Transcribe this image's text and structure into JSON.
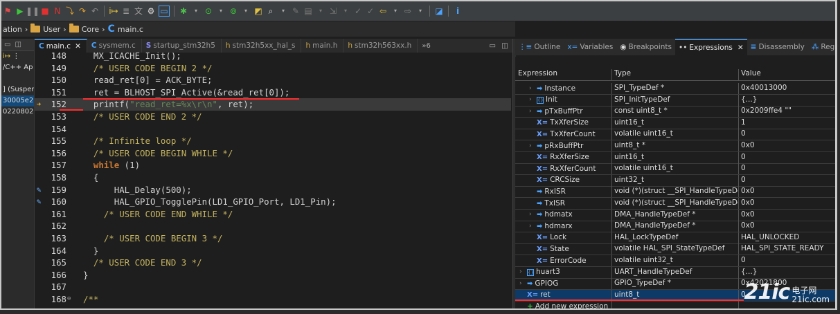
{
  "breadcrumb": {
    "items": [
      "ation",
      "User",
      "Core",
      "main.c"
    ]
  },
  "left_panel": {
    "rows": [
      "/C++ Ap",
      "",
      "] (Susper",
      "30005e2",
      "0220802"
    ]
  },
  "editor_tabs": [
    {
      "label": "main.c",
      "icon": "C",
      "active": true,
      "closable": true
    },
    {
      "label": "sysmem.c",
      "icon": "C"
    },
    {
      "label": "startup_stm32h5",
      "icon": "S"
    },
    {
      "label": "stm32h5xx_hal_s",
      "icon": "h"
    },
    {
      "label": "main.h",
      "icon": "h"
    },
    {
      "label": "stm32h563xx.h",
      "icon": "h"
    }
  ],
  "editor_overflow": "»6",
  "code_lines": [
    {
      "n": "148",
      "text": "  MX_ICACHE_Init();"
    },
    {
      "n": "149",
      "text": "  /* USER CODE BEGIN 2 */",
      "cls": "cm"
    },
    {
      "n": "150",
      "text": "  read_ret[0] = ACK_BYTE;"
    },
    {
      "n": "151",
      "text": "  ret = BLHOST_SPI_Active(&read_ret[0]);"
    },
    {
      "n": "152",
      "pre": "  printf(",
      "str": "\"read_ret=%x\\r\\n\"",
      "post": ", ret);",
      "current": true
    },
    {
      "n": "153",
      "text": "  /* USER CODE END 2 */",
      "cls": "cm"
    },
    {
      "n": "154",
      "text": ""
    },
    {
      "n": "155",
      "text": "  /* Infinite loop */",
      "cls": "cm"
    },
    {
      "n": "156",
      "text": "  /* USER CODE BEGIN WHILE */",
      "cls": "cm"
    },
    {
      "n": "157",
      "kw": "  while",
      "post": " (1)"
    },
    {
      "n": "158",
      "text": "  {"
    },
    {
      "n": "159",
      "text": "      HAL_Delay(500);"
    },
    {
      "n": "160",
      "text": "      HAL_GPIO_TogglePin(LD1_GPIO_Port, LD1_Pin);"
    },
    {
      "n": "161",
      "text": "    /* USER CODE END WHILE */",
      "cls": "cm"
    },
    {
      "n": "162",
      "text": ""
    },
    {
      "n": "163",
      "text": "    /* USER CODE BEGIN 3 */",
      "cls": "cm"
    },
    {
      "n": "164",
      "text": "  }"
    },
    {
      "n": "165",
      "text": "  /* USER CODE END 3 */",
      "cls": "cm"
    },
    {
      "n": "166",
      "text": "}"
    },
    {
      "n": "167",
      "text": ""
    },
    {
      "n": "168",
      "text": "/**",
      "cls": "cm"
    }
  ],
  "right_tabs": [
    {
      "label": "Outline"
    },
    {
      "label": "Variables"
    },
    {
      "label": "Breakpoints"
    },
    {
      "label": "Expressions",
      "active": true
    },
    {
      "label": "Disassembly"
    },
    {
      "label": "Registers"
    }
  ],
  "expressions": {
    "headers": [
      "Expression",
      "Type",
      "Value"
    ],
    "rows": [
      {
        "name": "Instance",
        "type": "SPI_TypeDef *",
        "value": "0x40013000",
        "icon": "pointer",
        "expand": true
      },
      {
        "name": "Init",
        "type": "SPI_InitTypeDef",
        "value": "{...}",
        "icon": "struct",
        "expand": true
      },
      {
        "name": "pTxBuffPtr",
        "type": "const uint8_t *",
        "value": "0x2009ffe4 \"\"",
        "icon": "pointer",
        "expand": true
      },
      {
        "name": "TxXferSize",
        "type": "uint16_t",
        "value": "1",
        "icon": "var"
      },
      {
        "name": "TxXferCount",
        "type": "volatile uint16_t",
        "value": "0",
        "icon": "var"
      },
      {
        "name": "pRxBuffPtr",
        "type": "uint8_t *",
        "value": "0x0",
        "icon": "pointer",
        "expand": true
      },
      {
        "name": "RxXferSize",
        "type": "uint16_t",
        "value": "0",
        "icon": "var"
      },
      {
        "name": "RxXferCount",
        "type": "volatile uint16_t",
        "value": "0",
        "icon": "var"
      },
      {
        "name": "CRCSize",
        "type": "uint32_t",
        "value": "0",
        "icon": "var"
      },
      {
        "name": "RxISR",
        "type": "void (*)(struct __SPI_HandleTypeDef...",
        "value": "0x0",
        "icon": "pointer"
      },
      {
        "name": "TxISR",
        "type": "void (*)(struct __SPI_HandleTypeDef...",
        "value": "0x0",
        "icon": "pointer"
      },
      {
        "name": "hdmatx",
        "type": "DMA_HandleTypeDef *",
        "value": "0x0",
        "icon": "pointer",
        "expand": true
      },
      {
        "name": "hdmarx",
        "type": "DMA_HandleTypeDef *",
        "value": "0x0",
        "icon": "pointer",
        "expand": true
      },
      {
        "name": "Lock",
        "type": "HAL_LockTypeDef",
        "value": "HAL_UNLOCKED",
        "icon": "var"
      },
      {
        "name": "State",
        "type": "volatile HAL_SPI_StateTypeDef",
        "value": "HAL_SPI_STATE_READY",
        "icon": "var"
      },
      {
        "name": "ErrorCode",
        "type": "volatile uint32_t",
        "value": "0",
        "icon": "var"
      },
      {
        "name": "huart3",
        "type": "UART_HandleTypeDef",
        "value": "{...}",
        "icon": "struct",
        "expand": true,
        "top": true
      },
      {
        "name": "GPIOG",
        "type": "GPIO_TypeDef *",
        "value": "0x42021800",
        "icon": "pointer",
        "expand": true,
        "top": true
      },
      {
        "name": "ret",
        "type": "uint8_t",
        "value": "0",
        "icon": "var",
        "selected": true,
        "top": true
      },
      {
        "name": "Add new expression",
        "type": "",
        "value": "",
        "icon": "add",
        "top": true
      }
    ]
  },
  "watermark": {
    "big": "21ic",
    "small1": "电子网",
    "small2": "21ic.com"
  },
  "colors": {
    "accent": "#4a88c7",
    "underline": "#ff2d2d",
    "selection": "#0d3a66"
  }
}
